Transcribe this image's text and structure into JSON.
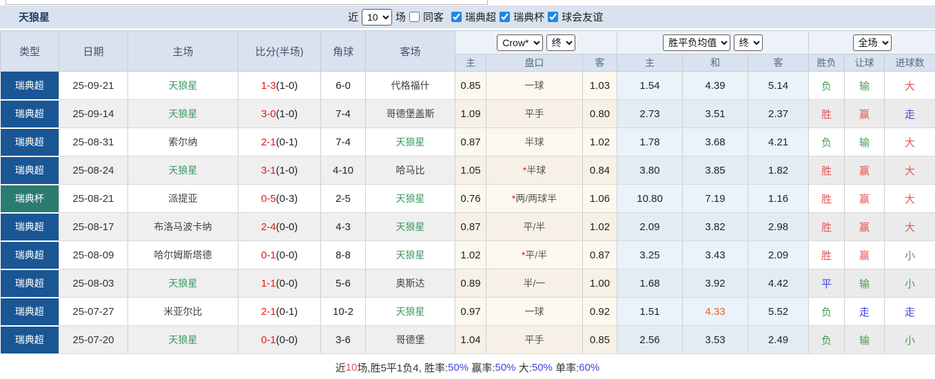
{
  "title": "天狼星",
  "topbar": {
    "recent_label": "近",
    "recent_select": "10",
    "matches_label": "场",
    "same_opponent_label": "同客",
    "same_opponent_checked": false,
    "filters": [
      {
        "label": "瑞典超",
        "checked": true
      },
      {
        "label": "瑞典杯",
        "checked": true
      },
      {
        "label": "球会友谊",
        "checked": true
      }
    ]
  },
  "table": {
    "columns": [
      "类型",
      "日期",
      "主场",
      "比分(半场)",
      "角球",
      "客场"
    ],
    "odds_group": {
      "select1": "Crow*",
      "select2": "终",
      "sub": [
        "主",
        "盘口",
        "客"
      ]
    },
    "avg_group": {
      "select1": "胜平负均值",
      "select2": "终",
      "sub": [
        "主",
        "和",
        "客"
      ]
    },
    "result_group": {
      "select1": "全场",
      "sub": [
        "胜负",
        "让球",
        "进球数"
      ]
    },
    "rows": [
      {
        "type": {
          "label": "瑞典超",
          "color": "blue"
        },
        "date": "25-09-21",
        "home": {
          "name": "天狼星",
          "self": true
        },
        "score": {
          "full": "1-3",
          "half": "(1-0)"
        },
        "corners": "6-0",
        "away": {
          "name": "代格福什",
          "self": false
        },
        "odds": {
          "home": "0.85",
          "star": false,
          "handicap": "一球",
          "away": "1.03"
        },
        "avg": {
          "home": "1.54",
          "draw": "4.39",
          "away": "5.14",
          "draw_color": ""
        },
        "results": {
          "win_lose": {
            "text": "负",
            "color": "green"
          },
          "handicap": {
            "text": "输",
            "color": "green"
          },
          "goals": {
            "text": "大",
            "color": "red"
          }
        }
      },
      {
        "type": {
          "label": "瑞典超",
          "color": "blue"
        },
        "date": "25-09-14",
        "home": {
          "name": "天狼星",
          "self": true
        },
        "score": {
          "full": "3-0",
          "half": "(1-0)"
        },
        "corners": "7-4",
        "away": {
          "name": "哥德堡盖斯",
          "self": false
        },
        "odds": {
          "home": "1.09",
          "star": false,
          "handicap": "平手",
          "away": "0.80"
        },
        "avg": {
          "home": "2.73",
          "draw": "3.51",
          "away": "2.37",
          "draw_color": ""
        },
        "results": {
          "win_lose": {
            "text": "胜",
            "color": "red"
          },
          "handicap": {
            "text": "赢",
            "color": "red"
          },
          "goals": {
            "text": "走",
            "color": "blue"
          }
        }
      },
      {
        "type": {
          "label": "瑞典超",
          "color": "blue"
        },
        "date": "25-08-31",
        "home": {
          "name": "索尔纳",
          "self": false
        },
        "score": {
          "full": "2-1",
          "half": "(0-1)"
        },
        "corners": "7-4",
        "away": {
          "name": "天狼星",
          "self": true
        },
        "odds": {
          "home": "0.87",
          "star": false,
          "handicap": "半球",
          "away": "1.02"
        },
        "avg": {
          "home": "1.78",
          "draw": "3.68",
          "away": "4.21",
          "draw_color": ""
        },
        "results": {
          "win_lose": {
            "text": "负",
            "color": "green"
          },
          "handicap": {
            "text": "输",
            "color": "green"
          },
          "goals": {
            "text": "大",
            "color": "red"
          }
        }
      },
      {
        "type": {
          "label": "瑞典超",
          "color": "blue"
        },
        "date": "25-08-24",
        "home": {
          "name": "天狼星",
          "self": true
        },
        "score": {
          "full": "3-1",
          "half": "(1-0)"
        },
        "corners": "4-10",
        "away": {
          "name": "哈马比",
          "self": false
        },
        "odds": {
          "home": "1.05",
          "star": true,
          "handicap": "半球",
          "away": "0.84"
        },
        "avg": {
          "home": "3.80",
          "draw": "3.85",
          "away": "1.82",
          "draw_color": ""
        },
        "results": {
          "win_lose": {
            "text": "胜",
            "color": "red"
          },
          "handicap": {
            "text": "赢",
            "color": "red"
          },
          "goals": {
            "text": "大",
            "color": "red"
          }
        }
      },
      {
        "type": {
          "label": "瑞典杯",
          "color": "teal"
        },
        "date": "25-08-21",
        "home": {
          "name": "派提亚",
          "self": false
        },
        "score": {
          "full": "0-5",
          "half": "(0-3)"
        },
        "corners": "2-5",
        "away": {
          "name": "天狼星",
          "self": true
        },
        "odds": {
          "home": "0.76",
          "star": true,
          "handicap": "两/两球半",
          "away": "1.06"
        },
        "avg": {
          "home": "10.80",
          "draw": "7.19",
          "away": "1.16",
          "draw_color": ""
        },
        "results": {
          "win_lose": {
            "text": "胜",
            "color": "red"
          },
          "handicap": {
            "text": "赢",
            "color": "red"
          },
          "goals": {
            "text": "大",
            "color": "red"
          }
        }
      },
      {
        "type": {
          "label": "瑞典超",
          "color": "blue"
        },
        "date": "25-08-17",
        "home": {
          "name": "布洛马波卡纳",
          "self": false
        },
        "score": {
          "full": "2-4",
          "half": "(0-0)"
        },
        "corners": "4-3",
        "away": {
          "name": "天狼星",
          "self": true
        },
        "odds": {
          "home": "0.87",
          "star": false,
          "handicap": "平/半",
          "away": "1.02"
        },
        "avg": {
          "home": "2.09",
          "draw": "3.82",
          "away": "2.98",
          "draw_color": ""
        },
        "results": {
          "win_lose": {
            "text": "胜",
            "color": "red"
          },
          "handicap": {
            "text": "赢",
            "color": "red"
          },
          "goals": {
            "text": "大",
            "color": "red"
          }
        }
      },
      {
        "type": {
          "label": "瑞典超",
          "color": "blue"
        },
        "date": "25-08-09",
        "home": {
          "name": "哈尔姆斯塔德",
          "self": false
        },
        "score": {
          "full": "0-1",
          "half": "(0-0)"
        },
        "corners": "8-8",
        "away": {
          "name": "天狼星",
          "self": true
        },
        "odds": {
          "home": "1.02",
          "star": true,
          "handicap": "平/半",
          "away": "0.87"
        },
        "avg": {
          "home": "3.25",
          "draw": "3.43",
          "away": "2.09",
          "draw_color": ""
        },
        "results": {
          "win_lose": {
            "text": "胜",
            "color": "red"
          },
          "handicap": {
            "text": "赢",
            "color": "red"
          },
          "goals": {
            "text": "小",
            "color": "green"
          }
        }
      },
      {
        "type": {
          "label": "瑞典超",
          "color": "blue"
        },
        "date": "25-08-03",
        "home": {
          "name": "天狼星",
          "self": true
        },
        "score": {
          "full": "1-1",
          "half": "(0-0)"
        },
        "corners": "5-6",
        "away": {
          "name": "奥斯达",
          "self": false
        },
        "odds": {
          "home": "0.89",
          "star": false,
          "handicap": "半/一",
          "away": "1.00"
        },
        "avg": {
          "home": "1.68",
          "draw": "3.92",
          "away": "4.42",
          "draw_color": ""
        },
        "results": {
          "win_lose": {
            "text": "平",
            "color": "blue"
          },
          "handicap": {
            "text": "输",
            "color": "green"
          },
          "goals": {
            "text": "小",
            "color": "green"
          }
        }
      },
      {
        "type": {
          "label": "瑞典超",
          "color": "blue"
        },
        "date": "25-07-27",
        "home": {
          "name": "米亚尔比",
          "self": false
        },
        "score": {
          "full": "2-1",
          "half": "(0-1)"
        },
        "corners": "10-2",
        "away": {
          "name": "天狼星",
          "self": true
        },
        "odds": {
          "home": "0.97",
          "star": false,
          "handicap": "一球",
          "away": "0.92"
        },
        "avg": {
          "home": "1.51",
          "draw": "4.33",
          "away": "5.52",
          "draw_color": "orange"
        },
        "results": {
          "win_lose": {
            "text": "负",
            "color": "green"
          },
          "handicap": {
            "text": "走",
            "color": "blue"
          },
          "goals": {
            "text": "走",
            "color": "blue"
          }
        }
      },
      {
        "type": {
          "label": "瑞典超",
          "color": "blue"
        },
        "date": "25-07-20",
        "home": {
          "name": "天狼星",
          "self": true
        },
        "score": {
          "full": "0-1",
          "half": "(0-0)"
        },
        "corners": "3-6",
        "away": {
          "name": "哥德堡",
          "self": false
        },
        "odds": {
          "home": "1.04",
          "star": false,
          "handicap": "平手",
          "away": "0.85"
        },
        "avg": {
          "home": "2.56",
          "draw": "3.53",
          "away": "2.49",
          "draw_color": ""
        },
        "results": {
          "win_lose": {
            "text": "负",
            "color": "green"
          },
          "handicap": {
            "text": "输",
            "color": "green"
          },
          "goals": {
            "text": "小",
            "color": "green"
          }
        }
      }
    ]
  },
  "footer": {
    "segments": [
      {
        "text": "近",
        "color": "dark"
      },
      {
        "text": "10",
        "color": "red"
      },
      {
        "text": "场,胜5平1负4, 胜率:",
        "color": "dark"
      },
      {
        "text": "50%",
        "color": "blue"
      },
      {
        "text": " 赢率:",
        "color": "dark"
      },
      {
        "text": "50%",
        "color": "blue"
      },
      {
        "text": " 大:",
        "color": "dark"
      },
      {
        "text": "50%",
        "color": "blue"
      },
      {
        "text": " 单率:",
        "color": "dark"
      },
      {
        "text": "60%",
        "color": "blue"
      }
    ]
  }
}
